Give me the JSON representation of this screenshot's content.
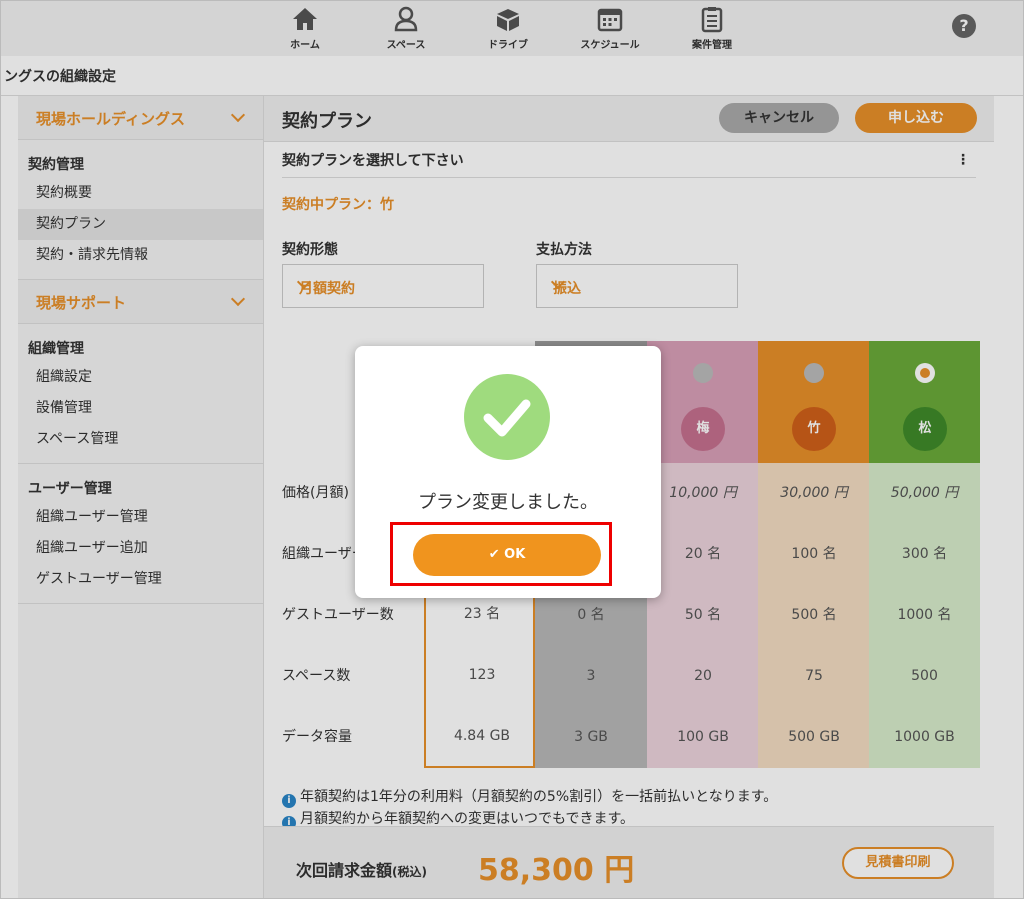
{
  "nav": {
    "items": [
      {
        "label": "ホーム",
        "icon": "home-icon"
      },
      {
        "label": "スペース",
        "icon": "space-icon"
      },
      {
        "label": "ドライブ",
        "icon": "drive-icon"
      },
      {
        "label": "スケジュール",
        "icon": "calendar-icon"
      },
      {
        "label": "案件管理",
        "icon": "clipboard-icon"
      }
    ],
    "help": "?"
  },
  "page_title": "ングスの組織設定",
  "sidebar": {
    "org_selector": "現場ホールディングス",
    "contract": {
      "title": "契約管理",
      "items": [
        "契約概要",
        "契約プラン",
        "契約・請求先情報"
      ]
    },
    "support_selector": "現場サポート",
    "org": {
      "title": "組織管理",
      "items": [
        "組織設定",
        "設備管理",
        "スペース管理"
      ]
    },
    "users": {
      "title": "ユーザー管理",
      "items": [
        "組織ユーザー管理",
        "組織ユーザー追加",
        "ゲストユーザー管理"
      ]
    }
  },
  "main": {
    "title": "契約プラン",
    "cancel_label": "キャンセル",
    "apply_label": "申し込む",
    "subtitle": "契約プランを選択して下さい",
    "kebab": "⋮",
    "current_plan": "契約中プラン：竹",
    "contract_type": {
      "label": "契約形態",
      "value": "月額契約"
    },
    "payment": {
      "label": "支払方法",
      "value": "振込"
    },
    "row_labels": [
      "価格(月額)",
      "組織ユーザー数",
      "ゲストユーザー数",
      "スペース数",
      "データ容量"
    ],
    "current_usage": {
      "guests": "23 名",
      "spaces": "123",
      "data": "4.84 GB"
    },
    "plans": [
      {
        "name": "",
        "color": "#9e9e9e",
        "price": "",
        "users": "",
        "guests": "0 名",
        "spaces": "3",
        "data": "3 GB"
      },
      {
        "name": "梅",
        "color": "#d9a0b8",
        "price": "10,000 円",
        "users": "20 名",
        "guests": "50 名",
        "spaces": "20",
        "data": "100 GB"
      },
      {
        "name": "竹",
        "color": "#e8902a",
        "price": "30,000 円",
        "users": "100 名",
        "guests": "500 名",
        "spaces": "75",
        "data": "500 GB"
      },
      {
        "name": "松",
        "color": "#6aaa3a",
        "price": "50,000 円",
        "users": "300 名",
        "guests": "1000 名",
        "spaces": "500",
        "data": "1000 GB"
      }
    ],
    "notes": [
      "年額契約は1年分の利用料（月額契約の5%割引）を一括前払いとなります。",
      "月額契約から年額契約への変更はいつでもできます。"
    ],
    "footer": {
      "label": "次回請求金額",
      "label_small": "(税込)",
      "amount": "58,300 円",
      "estimate_label": "見積書印刷"
    }
  },
  "modal": {
    "message": "プラン変更しました。",
    "ok_label": "✔ OK"
  }
}
